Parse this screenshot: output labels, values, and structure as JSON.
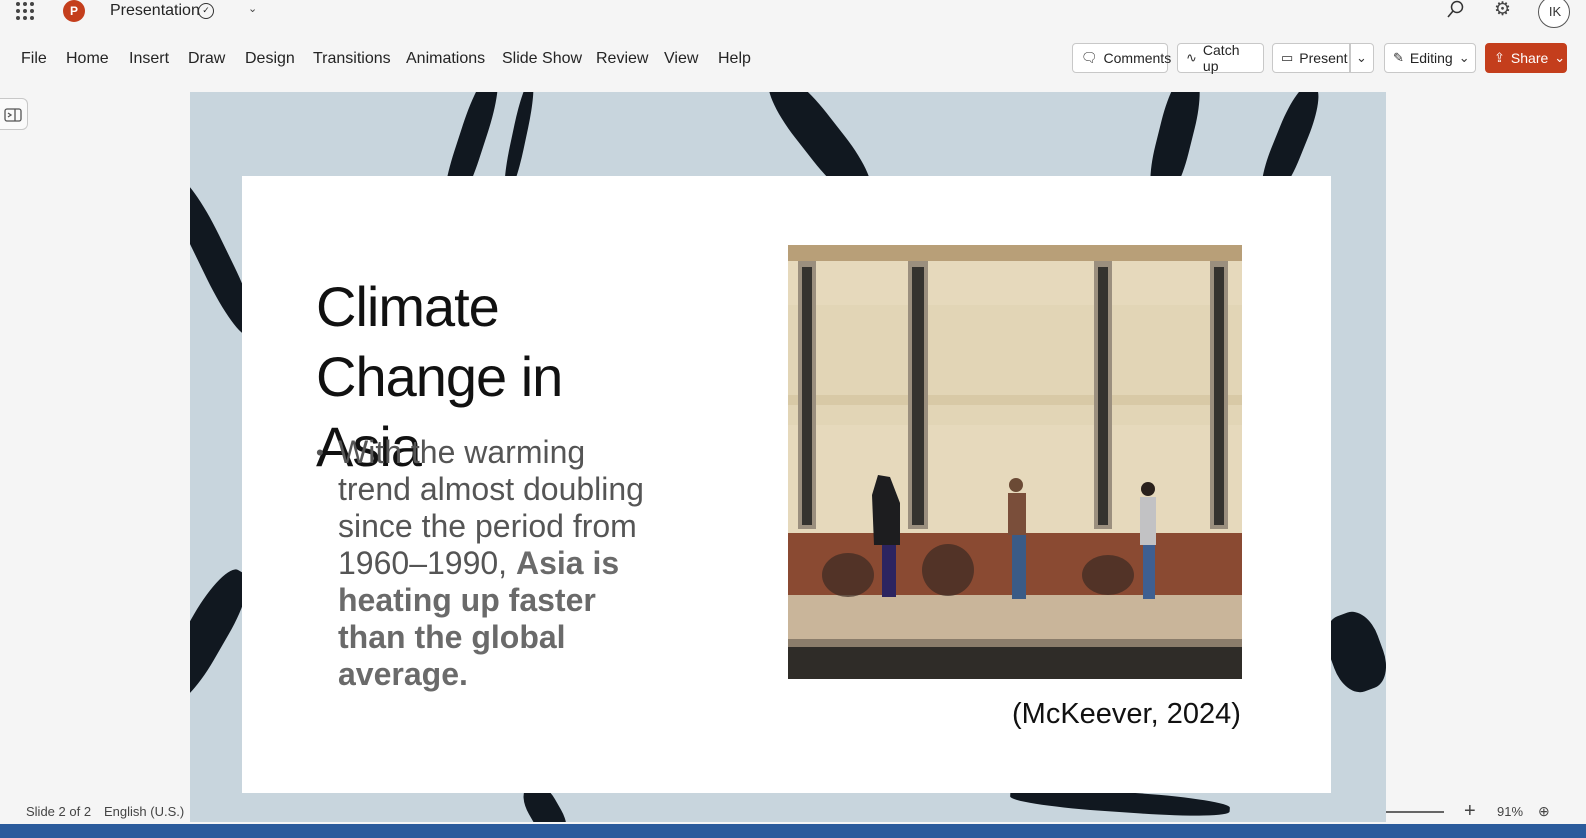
{
  "app": {
    "name": "PowerPoint",
    "logo_letter": "P",
    "doc_title": "Presentation",
    "avatar_initials": "IK",
    "accent": "#c43e1c"
  },
  "ribbon": {
    "menus": [
      "File",
      "Home",
      "Insert",
      "Draw",
      "Design",
      "Transitions",
      "Animations",
      "Slide Show",
      "Review",
      "View",
      "Help"
    ],
    "comments_label": "Comments",
    "catchup_label": "Catch up",
    "present_label": "Present",
    "editing_label": "Editing",
    "share_label": "Share"
  },
  "slide": {
    "title_line1": "Climate",
    "title_line2": "Change in Asia",
    "bullet_plain": "With the warming trend almost doubling since the period from 1960–1990, ",
    "bullet_bold": "Asia is heating up faster than the global average.",
    "citation": "(McKeever, 2024)",
    "background_color": "#c8d5dd"
  },
  "status": {
    "slide_indicator": "Slide 2 of 2",
    "language": "English (U.S.)",
    "zoom": "91%"
  }
}
